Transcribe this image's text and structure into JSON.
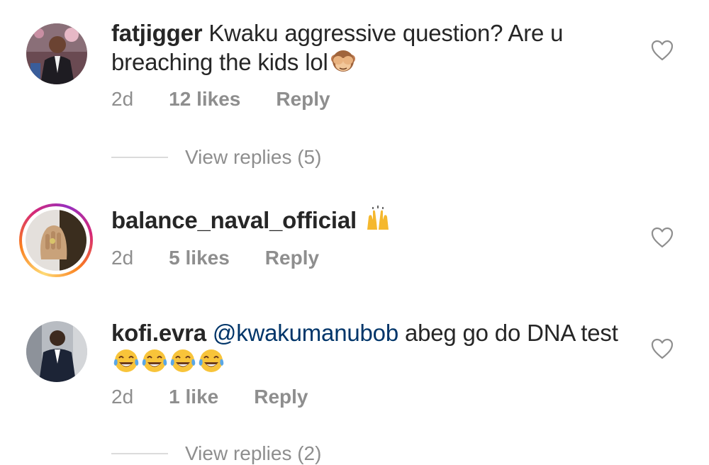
{
  "comments": [
    {
      "username": "fatjigger",
      "text": "Kwaku aggressive question? Are u breaching the kids lol",
      "emoji": [
        "see-no-evil-monkey"
      ],
      "time": "2d",
      "likes": "12 likes",
      "reply": "Reply",
      "view_replies": "View replies (5)"
    },
    {
      "username": "balance_naval_official",
      "text": "",
      "emoji": [
        "raising-hands"
      ],
      "time": "2d",
      "likes": "5 likes",
      "reply": "Reply"
    },
    {
      "username": "kofi.evra",
      "mention": "@kwakumanubob",
      "text": "abeg go do DNA test",
      "emoji": [
        "tears-of-joy",
        "tears-of-joy",
        "tears-of-joy",
        "tears-of-joy"
      ],
      "time": "2d",
      "likes": "1 like",
      "reply": "Reply",
      "view_replies": "View replies (2)"
    }
  ],
  "icons": {
    "like": "heart-outline-icon"
  },
  "colors": {
    "text": "#262626",
    "muted": "#8e8e8e",
    "mention": "#003569",
    "divider": "#dbdbdb"
  }
}
